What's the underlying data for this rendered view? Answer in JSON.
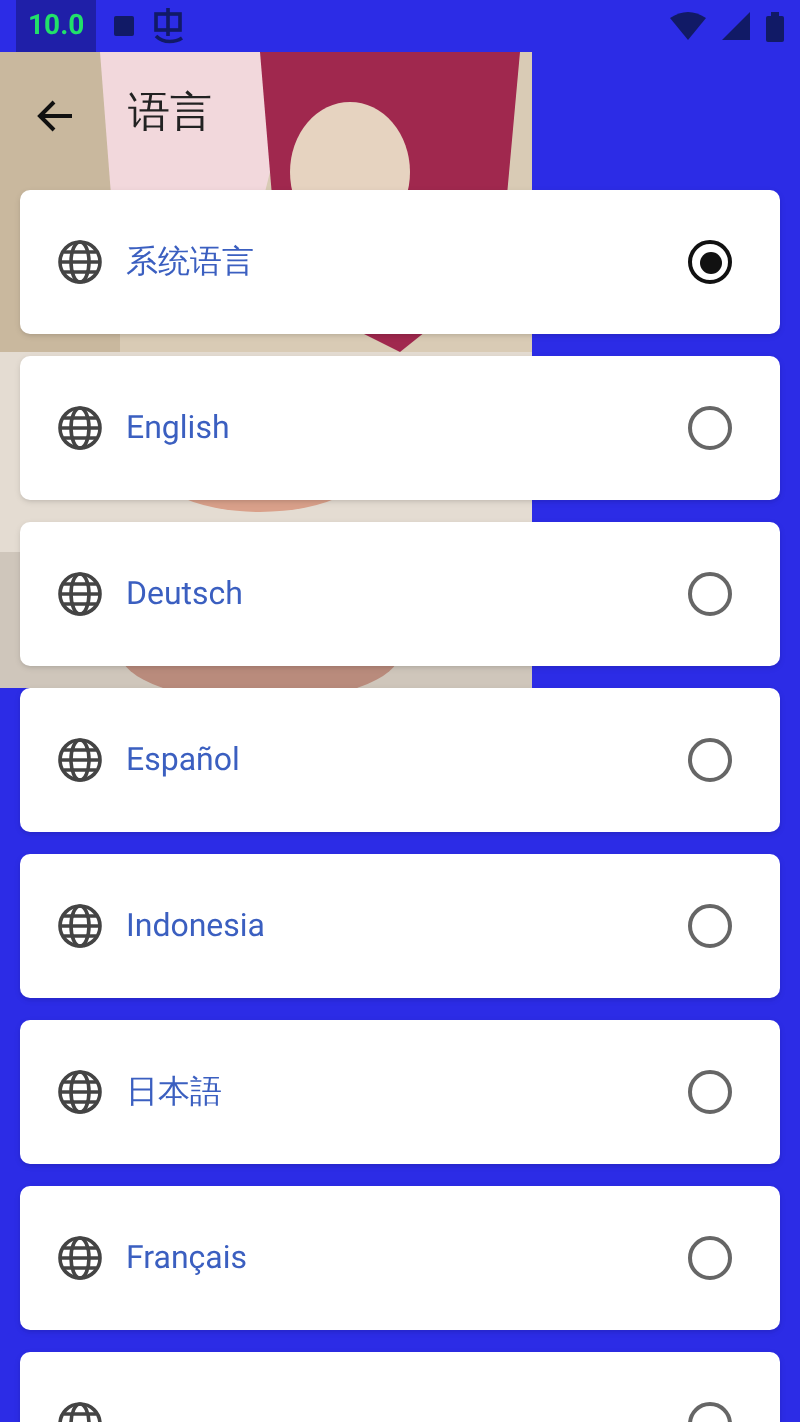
{
  "status_bar": {
    "badge": "10.0"
  },
  "header": {
    "title": "语言"
  },
  "languages": [
    {
      "name": "系统语言",
      "selected": true
    },
    {
      "name": "English",
      "selected": false
    },
    {
      "name": "Deutsch",
      "selected": false
    },
    {
      "name": "Español",
      "selected": false
    },
    {
      "name": "Indonesia",
      "selected": false
    },
    {
      "name": "日本語",
      "selected": false
    },
    {
      "name": "Français",
      "selected": false
    },
    {
      "selected": false
    }
  ]
}
